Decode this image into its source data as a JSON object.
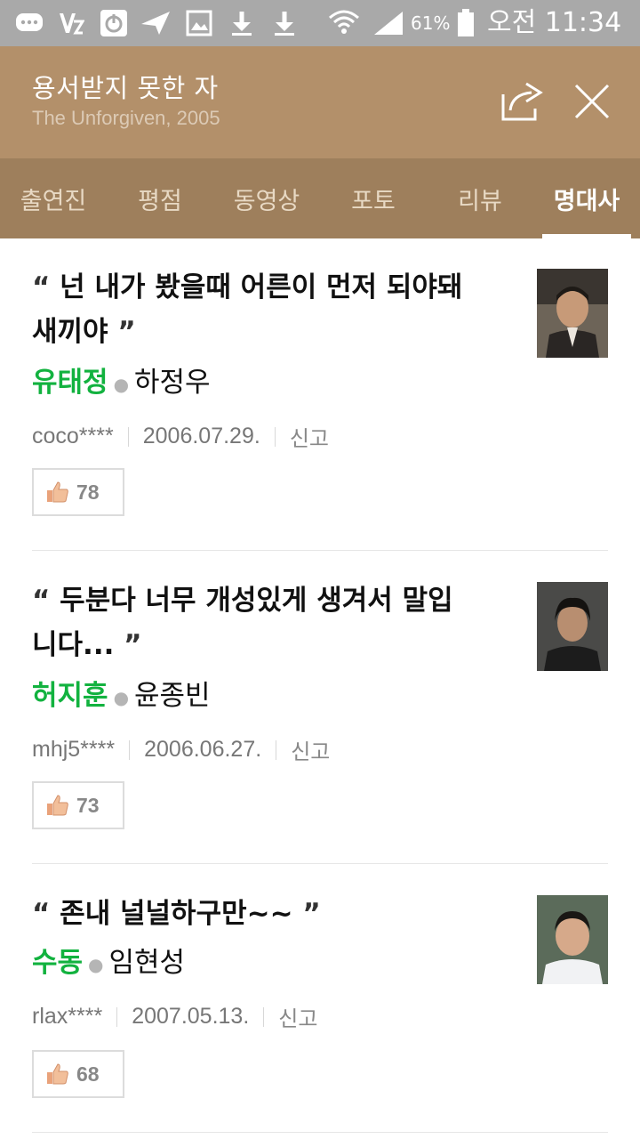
{
  "status_bar": {
    "battery": "61%",
    "time": "오전 11:34"
  },
  "header": {
    "title": "용서받지 못한 자",
    "subtitle": "The Unforgiven, 2005"
  },
  "tabs": [
    {
      "label": "출연진",
      "active": false
    },
    {
      "label": "평점",
      "active": false
    },
    {
      "label": "동영상",
      "active": false
    },
    {
      "label": "포토",
      "active": false
    },
    {
      "label": "리뷰",
      "active": false
    },
    {
      "label": "명대사",
      "active": true
    }
  ],
  "quotes": [
    {
      "open_mark": "“",
      "line1": "넌 내가 봤을때 어른이 먼저 되야돼",
      "line2": "새끼야",
      "close_mark": "”",
      "role": "유태정",
      "actor": "하정우",
      "user": "coco****",
      "date": "2006.07.29.",
      "report": "신고",
      "likes": "78"
    },
    {
      "open_mark": "“",
      "line1": "두분다 너무 개성있게 생겨서 말입",
      "line2": "니다...",
      "close_mark": "”",
      "role": "허지훈",
      "actor": "윤종빈",
      "user": "mhj5****",
      "date": "2006.06.27.",
      "report": "신고",
      "likes": "73"
    },
    {
      "open_mark": "“",
      "line1": "존내 널널하구만~~",
      "line2": "",
      "close_mark": "”",
      "role": "수동",
      "actor": "임현성",
      "user": "rlax****",
      "date": "2007.05.13.",
      "report": "신고",
      "likes": "68"
    }
  ],
  "colors": {
    "header_bg": "#b3906a",
    "tabs_bg": "#9e7f5c",
    "role_green": "#12b23f",
    "status_bar": "#a9a9a9"
  }
}
